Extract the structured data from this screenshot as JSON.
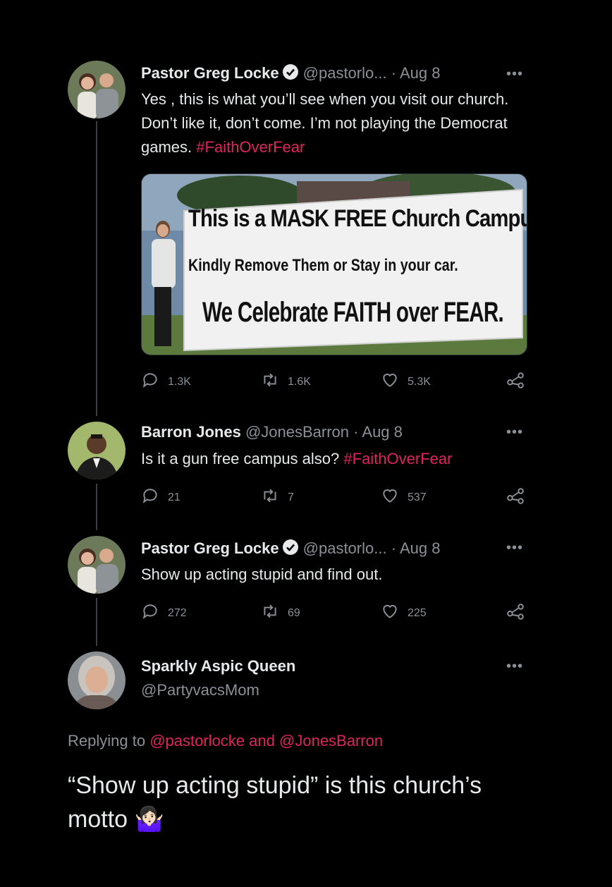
{
  "tweets": [
    {
      "name": "Pastor Greg Locke",
      "handle": "@pastorlo...",
      "dot": "·",
      "date": "Aug 8",
      "text": "Yes , this is what you’ll see when you visit our church. Don’t like it, don’t come. I’m not playing the Democrat games.",
      "hashtag": "#FaithOverFear",
      "counts": {
        "replies": "1.3K",
        "retweets": "1.6K",
        "likes": "5.3K"
      },
      "banner": {
        "line1": "This is a MASK FREE Church Campus.",
        "line2": "Kindly Remove Them or Stay in your car.",
        "line3": "We Celebrate FAITH over FEAR."
      }
    },
    {
      "name": "Barron Jones",
      "handle": "@JonesBarron",
      "dot": "·",
      "date": "Aug 8",
      "text": "Is it a gun free campus also?",
      "hashtag": "#FaithOverFear",
      "counts": {
        "replies": "21",
        "retweets": "7",
        "likes": "537"
      }
    },
    {
      "name": "Pastor Greg Locke",
      "handle": "@pastorlo...",
      "dot": "·",
      "date": "Aug 8",
      "text": "Show up acting stupid and find out.",
      "counts": {
        "replies": "272",
        "retweets": "69",
        "likes": "225"
      }
    }
  ],
  "main_reply": {
    "name": "Sparkly Aspic Queen",
    "handle": "@PartyvacsMom",
    "replying_prefix": "Replying to",
    "mention1": "@pastorlocke",
    "and": "and",
    "mention2": "@JonesBarron",
    "text": "“Show up acting stupid” is this church’s motto",
    "emoji": "🤷🏻‍♀️"
  },
  "more_glyph": "•••",
  "colors": {
    "accent": "#e0245e",
    "verified": "#1d9bf0",
    "muted": "#8b9096",
    "bg": "#000000"
  }
}
